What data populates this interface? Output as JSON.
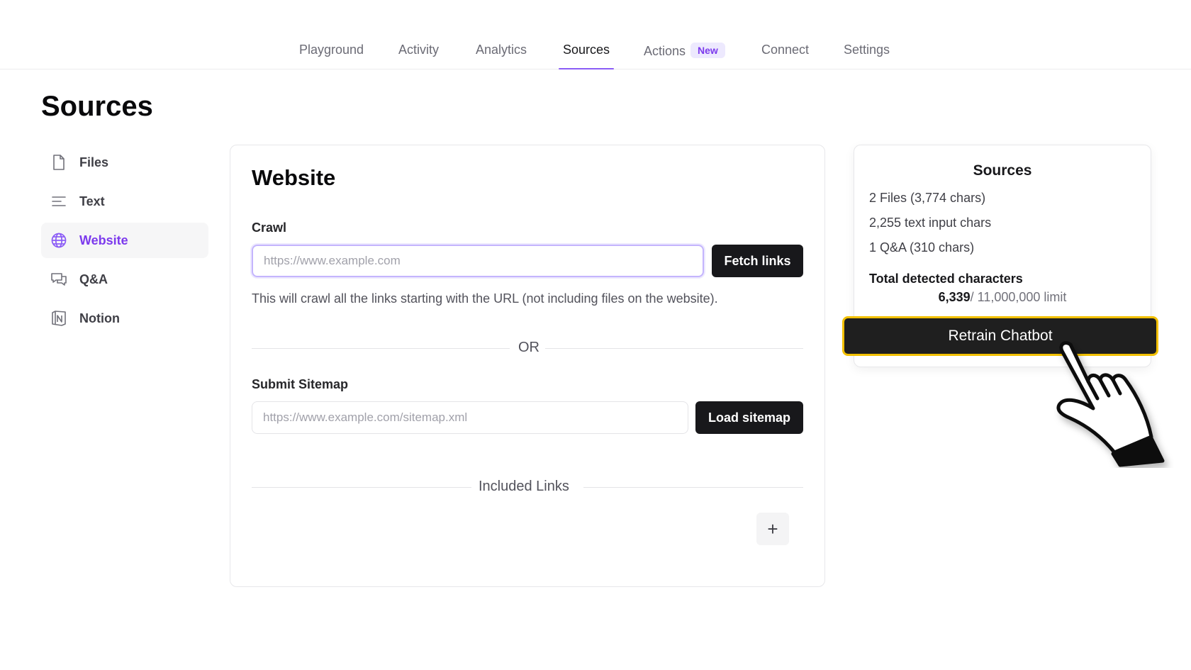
{
  "nav": {
    "tabs": [
      {
        "label": "Playground"
      },
      {
        "label": "Activity"
      },
      {
        "label": "Analytics"
      },
      {
        "label": "Sources"
      },
      {
        "label": "Actions",
        "badge": "New"
      },
      {
        "label": "Connect"
      },
      {
        "label": "Settings"
      }
    ],
    "active_tab": "Sources",
    "accent_color": "#8b5cf6"
  },
  "page": {
    "title": "Sources"
  },
  "sidebar": {
    "items": [
      {
        "label": "Files",
        "icon": "file-icon"
      },
      {
        "label": "Text",
        "icon": "text-lines-icon"
      },
      {
        "label": "Website",
        "icon": "globe-icon",
        "active": true
      },
      {
        "label": "Q&A",
        "icon": "chat-bubbles-icon"
      },
      {
        "label": "Notion",
        "icon": "notion-icon"
      }
    ]
  },
  "website": {
    "title": "Website",
    "crawl": {
      "label": "Crawl",
      "placeholder": "https://www.example.com",
      "value": "",
      "button": "Fetch links",
      "helper": "This will crawl all the links starting with the URL (not including files on the website)."
    },
    "or_label": "OR",
    "sitemap": {
      "label": "Submit Sitemap",
      "placeholder": "https://www.example.com/sitemap.xml",
      "value": "",
      "button": "Load sitemap"
    },
    "included_links": {
      "label": "Included Links",
      "add_button": "+"
    }
  },
  "summary": {
    "title": "Sources",
    "lines": [
      "2 Files (3,774 chars)",
      "2,255 text input chars",
      "1 Q&A (310 chars)"
    ],
    "total_label": "Total detected characters",
    "total_value": "6,339",
    "total_limit": "/ 11,000,000 limit",
    "retrain_button": "Retrain Chatbot",
    "highlight_color": "#f2c000"
  }
}
